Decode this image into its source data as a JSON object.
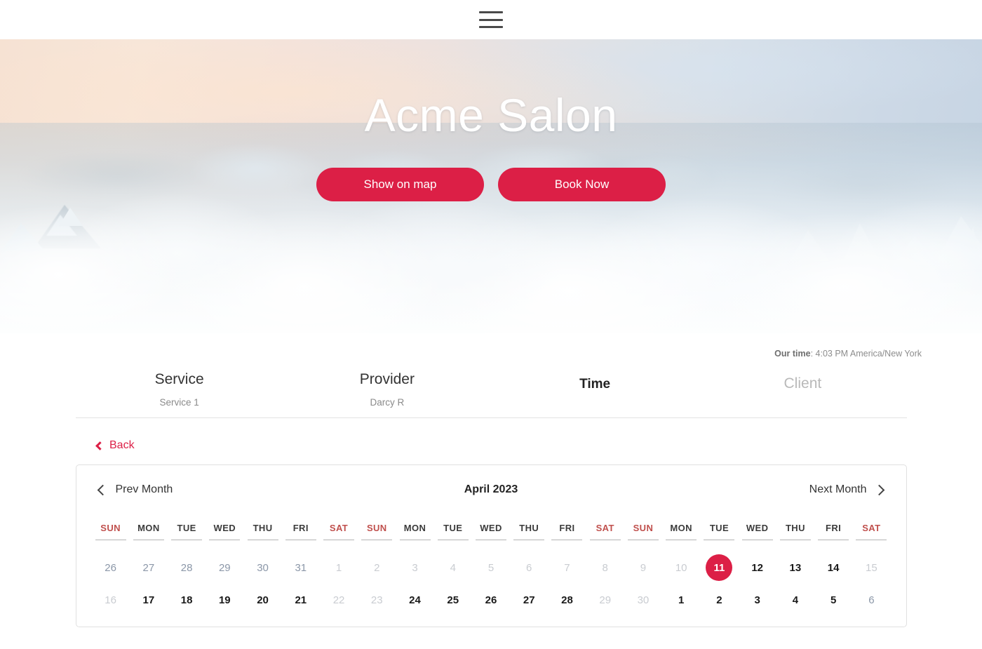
{
  "nav": {
    "menu_icon": "hamburger-menu-icon"
  },
  "hero": {
    "title": "Acme Salon",
    "buttons": [
      {
        "label": "Show on map",
        "name": "show-on-map-button"
      },
      {
        "label": "Book Now",
        "name": "book-now-button"
      }
    ],
    "accent_color": "#dc1f46"
  },
  "our_time": {
    "label": "Our time",
    "separator": ": ",
    "value": "4:03 PM America/New York"
  },
  "steps": [
    {
      "title": "Service",
      "value": "Service 1",
      "state": "done"
    },
    {
      "title": "Provider",
      "value": "Darcy R",
      "state": "done"
    },
    {
      "title": "Time",
      "value": "",
      "state": "active"
    },
    {
      "title": "Client",
      "value": "",
      "state": "upcoming"
    }
  ],
  "back": {
    "label": "Back",
    "icon": "chevron-left-icon"
  },
  "calendar": {
    "prev_label": "Prev Month",
    "next_label": "Next Month",
    "month_label": "April 2023",
    "weekend_color": "#c0504d",
    "selected_color": "#dc1f46",
    "day_headers": [
      "SUN",
      "MON",
      "TUE",
      "WED",
      "THU",
      "FRI",
      "SAT",
      "SUN",
      "MON",
      "TUE",
      "WED",
      "THU",
      "FRI",
      "SAT",
      "SUN",
      "MON",
      "TUE",
      "WED",
      "THU",
      "FRI",
      "SAT"
    ],
    "weeks": [
      [
        {
          "n": "26",
          "state": "othermonth"
        },
        {
          "n": "27",
          "state": "othermonth"
        },
        {
          "n": "28",
          "state": "othermonth"
        },
        {
          "n": "29",
          "state": "othermonth"
        },
        {
          "n": "30",
          "state": "othermonth"
        },
        {
          "n": "31",
          "state": "othermonth"
        },
        {
          "n": "1",
          "state": "dim"
        },
        {
          "n": "2",
          "state": "dim"
        },
        {
          "n": "3",
          "state": "dim"
        },
        {
          "n": "4",
          "state": "dim"
        },
        {
          "n": "5",
          "state": "dim"
        },
        {
          "n": "6",
          "state": "dim"
        },
        {
          "n": "7",
          "state": "dim"
        },
        {
          "n": "8",
          "state": "dim"
        },
        {
          "n": "9",
          "state": "dim"
        },
        {
          "n": "10",
          "state": "dim"
        },
        {
          "n": "11",
          "state": "selected"
        },
        {
          "n": "12",
          "state": "avail"
        },
        {
          "n": "13",
          "state": "avail"
        },
        {
          "n": "14",
          "state": "avail"
        },
        {
          "n": "15",
          "state": "dim"
        }
      ],
      [
        {
          "n": "16",
          "state": "dim"
        },
        {
          "n": "17",
          "state": "avail"
        },
        {
          "n": "18",
          "state": "avail"
        },
        {
          "n": "19",
          "state": "avail"
        },
        {
          "n": "20",
          "state": "avail"
        },
        {
          "n": "21",
          "state": "avail"
        },
        {
          "n": "22",
          "state": "dim"
        },
        {
          "n": "23",
          "state": "dim"
        },
        {
          "n": "24",
          "state": "avail"
        },
        {
          "n": "25",
          "state": "avail"
        },
        {
          "n": "26",
          "state": "avail"
        },
        {
          "n": "27",
          "state": "avail"
        },
        {
          "n": "28",
          "state": "avail"
        },
        {
          "n": "29",
          "state": "dim"
        },
        {
          "n": "30",
          "state": "dim"
        },
        {
          "n": "1",
          "state": "avail"
        },
        {
          "n": "2",
          "state": "avail"
        },
        {
          "n": "3",
          "state": "avail"
        },
        {
          "n": "4",
          "state": "avail"
        },
        {
          "n": "5",
          "state": "avail"
        },
        {
          "n": "6",
          "state": "othermonth"
        }
      ]
    ]
  }
}
